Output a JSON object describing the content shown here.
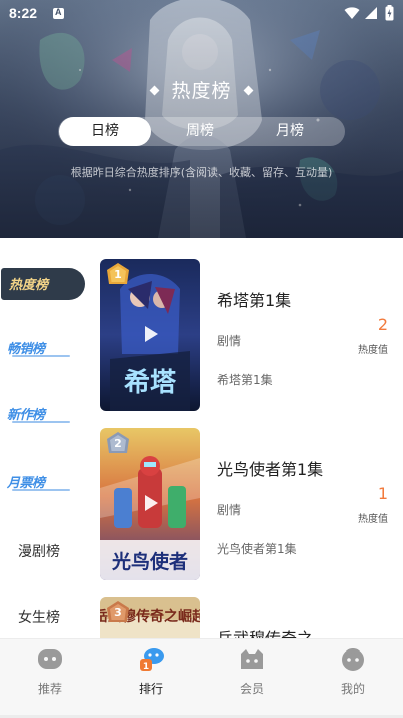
{
  "status_bar": {
    "time": "8:22"
  },
  "header": {
    "title": "热度榜",
    "tabs": [
      {
        "label": "日榜",
        "active": true
      },
      {
        "label": "周榜",
        "active": false
      },
      {
        "label": "月榜",
        "active": false
      }
    ],
    "description": "根据昨日综合热度排序(含阅读、收藏、留存、互动量)"
  },
  "sidebar": {
    "items": [
      {
        "label": "热度榜",
        "icon": "hot-list-logo",
        "active": true
      },
      {
        "label": "畅销榜",
        "icon": "bestseller-list-logo",
        "active": false
      },
      {
        "label": "新作榜",
        "icon": "new-works-list-logo",
        "active": false
      },
      {
        "label": "月票榜",
        "icon": "monthly-ticket-list-logo",
        "active": false
      },
      {
        "label": "漫剧榜",
        "active": false
      },
      {
        "label": "女生榜",
        "active": false
      }
    ]
  },
  "ranking": {
    "items": [
      {
        "rank": "1",
        "title": "希塔第1集",
        "genre": "剧情",
        "heat": "2",
        "heat_label": "热度值",
        "subtitle": "希塔第1集",
        "cover_text": "希塔"
      },
      {
        "rank": "2",
        "title": "光鸟使者第1集",
        "genre": "剧情",
        "heat": "1",
        "heat_label": "热度值",
        "subtitle": "光鸟使者第1集",
        "cover_text": "光鸟使者"
      },
      {
        "rank": "3",
        "title": "岳武穆传奇之",
        "genre": "",
        "heat": "",
        "heat_label": "",
        "subtitle": "",
        "cover_text": "岳武穆传奇之崛起"
      }
    ]
  },
  "bottom_nav": {
    "items": [
      {
        "label": "推荐",
        "icon": "recommend-icon",
        "active": false
      },
      {
        "label": "排行",
        "icon": "ranking-icon",
        "active": true
      },
      {
        "label": "会员",
        "icon": "vip-icon",
        "active": false
      },
      {
        "label": "我的",
        "icon": "profile-icon",
        "active": false
      }
    ]
  },
  "colors": {
    "accent": "#f27a3c",
    "active_tab_bg": "#ffffff",
    "sidebar_logo_blue": "#3f8fe6",
    "active_nav_icon": "#3a9aee"
  }
}
